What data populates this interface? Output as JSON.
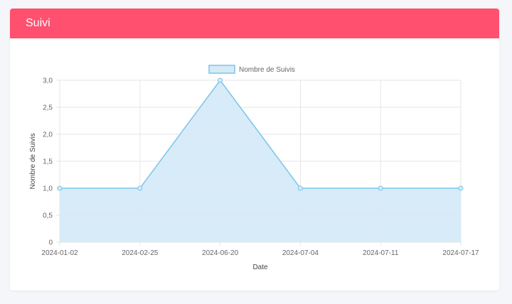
{
  "card": {
    "title": "Suivi"
  },
  "chart_data": {
    "type": "area",
    "x": [
      "2024-01-02",
      "2024-02-25",
      "2024-06-20",
      "2024-07-04",
      "2024-07-11",
      "2024-07-17"
    ],
    "series": [
      {
        "name": "Nombre de Suivis",
        "values": [
          1,
          1,
          3,
          1,
          1,
          1
        ]
      }
    ],
    "xlabel": "Date",
    "ylabel": "Nombre de Suivis",
    "ylim": [
      0,
      3
    ],
    "yticks": [
      "0",
      "0,5",
      "1,0",
      "1,5",
      "2,0",
      "2,5",
      "3,0"
    ],
    "grid": true,
    "legend": "top-center",
    "colors": {
      "line": "#7cc4ea",
      "fill": "#d6eaf8",
      "grid": "#e6e6e6"
    }
  }
}
